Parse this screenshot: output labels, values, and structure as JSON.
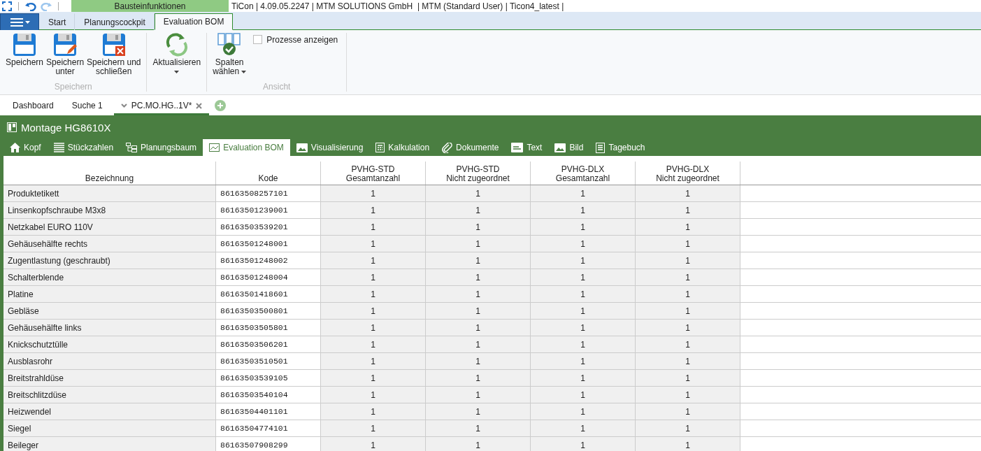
{
  "context_tab": "Bausteinfunktionen",
  "title": "TiCon | 4.09.05.2247 | MTM SOLUTIONS GmbH  | MTM (Standard User) | Ticon4_latest |",
  "ribbon_tabs": [
    {
      "label": "Start",
      "selected": false
    },
    {
      "label": "Planungscockpit",
      "selected": false
    },
    {
      "label": "Evaluation BOM",
      "selected": true
    }
  ],
  "ribbon_groups": [
    {
      "label": "Speichern",
      "buttons": [
        {
          "kind": "save",
          "lines": [
            "Speichern"
          ]
        },
        {
          "kind": "saveas",
          "lines": [
            "Speichern",
            "unter"
          ]
        },
        {
          "kind": "saveclose",
          "lines": [
            "Speichern und",
            "schließen"
          ]
        }
      ]
    },
    {
      "buttons": [
        {
          "kind": "refresh",
          "lines": [
            "Aktualisieren"
          ],
          "dropdown": true
        }
      ]
    },
    {
      "label": "Ansicht",
      "buttons": [
        {
          "kind": "columns",
          "lines": [
            "Spalten",
            "wählen"
          ],
          "dropdown": true
        }
      ],
      "checkbox": {
        "label": "Prozesse anzeigen",
        "checked": false
      }
    }
  ],
  "doc_tabs": [
    {
      "label": "Dashboard",
      "selected": false
    },
    {
      "label": "Suche 1",
      "selected": false
    },
    {
      "label": "PC.MO.HG..1V*",
      "selected": true
    }
  ],
  "document": {
    "title": "Montage HG8610X",
    "tabs": [
      {
        "label": "Kopf",
        "kind": "home",
        "selected": false
      },
      {
        "label": "Stückzahlen",
        "kind": "list",
        "selected": false
      },
      {
        "label": "Planungsbaum",
        "kind": "tree",
        "selected": false
      },
      {
        "label": "Evaluation BOM",
        "kind": "chart",
        "selected": true
      },
      {
        "label": "Visualisierung",
        "kind": "image",
        "selected": false
      },
      {
        "label": "Kalkulation",
        "kind": "calc",
        "selected": false
      },
      {
        "label": "Dokumente",
        "kind": "clip",
        "selected": false
      },
      {
        "label": "Text",
        "kind": "abc",
        "selected": false
      },
      {
        "label": "Bild",
        "kind": "image",
        "selected": false
      },
      {
        "label": "Tagebuch",
        "kind": "book",
        "selected": false
      }
    ]
  },
  "table": {
    "columns": [
      {
        "lines": [
          "Bezeichnung"
        ]
      },
      {
        "lines": [
          "Kode"
        ]
      },
      {
        "lines": [
          "PVHG-STD",
          "Gesamtanzahl"
        ]
      },
      {
        "lines": [
          "PVHG-STD",
          "Nicht zugeordnet"
        ]
      },
      {
        "lines": [
          "PVHG-DLX",
          "Gesamtanzahl"
        ]
      },
      {
        "lines": [
          "PVHG-DLX",
          "Nicht zugeordnet"
        ]
      }
    ],
    "rows": [
      {
        "name": "Produktetikett",
        "code": "86163508257101",
        "values": [
          "1",
          "1",
          "1",
          "1"
        ]
      },
      {
        "name": "Linsenkopfschraube  M3x8",
        "code": "86163501239001",
        "values": [
          "1",
          "1",
          "1",
          "1"
        ]
      },
      {
        "name": "Netzkabel EURO 110V",
        "code": "86163503539201",
        "values": [
          "1",
          "1",
          "1",
          "1"
        ]
      },
      {
        "name": "Gehäusehälfte rechts",
        "code": "86163501248001",
        "values": [
          "1",
          "1",
          "1",
          "1"
        ]
      },
      {
        "name": "Zugentlastung (geschraubt)",
        "code": "86163501248002",
        "values": [
          "1",
          "1",
          "1",
          "1"
        ]
      },
      {
        "name": "Schalterblende",
        "code": "86163501248004",
        "values": [
          "1",
          "1",
          "1",
          "1"
        ]
      },
      {
        "name": "Platine",
        "code": "86163501418601",
        "values": [
          "1",
          "1",
          "1",
          "1"
        ]
      },
      {
        "name": "Gebläse",
        "code": "86163503500801",
        "values": [
          "1",
          "1",
          "1",
          "1"
        ]
      },
      {
        "name": "Gehäusehälfte links",
        "code": "86163503505801",
        "values": [
          "1",
          "1",
          "1",
          "1"
        ]
      },
      {
        "name": "Knickschutztülle",
        "code": "86163503506201",
        "values": [
          "1",
          "1",
          "1",
          "1"
        ]
      },
      {
        "name": "Ausblasrohr",
        "code": "86163503510501",
        "values": [
          "1",
          "1",
          "1",
          "1"
        ]
      },
      {
        "name": "Breitstrahldüse",
        "code": "86163503539105",
        "values": [
          "1",
          "1",
          "1",
          "1"
        ]
      },
      {
        "name": "Breitschlitzdüse",
        "code": "86163503540104",
        "values": [
          "1",
          "1",
          "1",
          "1"
        ]
      },
      {
        "name": "Heizwendel",
        "code": "86163504401101",
        "values": [
          "1",
          "1",
          "1",
          "1"
        ]
      },
      {
        "name": "Siegel",
        "code": "86163504774101",
        "values": [
          "1",
          "1",
          "1",
          "1"
        ]
      },
      {
        "name": "Beileger",
        "code": "86163507908299",
        "values": [
          "1",
          "1",
          "1",
          "1"
        ]
      }
    ]
  }
}
